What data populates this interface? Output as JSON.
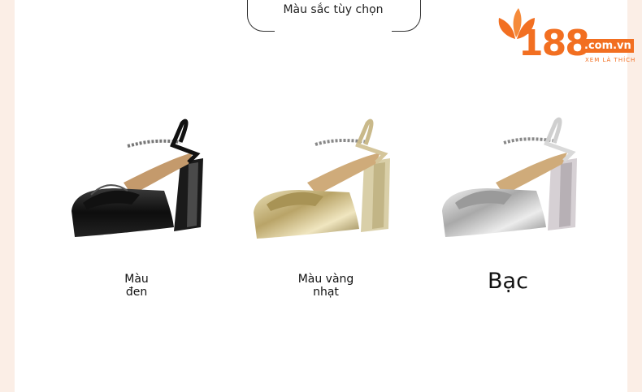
{
  "header": {
    "color_selector_label": "Màu sắc tùy chọn"
  },
  "logo": {
    "number": "188",
    "domain": ".com.vn",
    "tagline": "XEM LÀ THÍCH",
    "icon": "flower-icon",
    "brand_color": "#f26f21"
  },
  "products": [
    {
      "label": "Màu đen",
      "shoe_color": "black"
    },
    {
      "label": "Màu vàng nhạt",
      "shoe_color": "gold"
    },
    {
      "label": "Bạc",
      "shoe_color": "silver"
    }
  ]
}
